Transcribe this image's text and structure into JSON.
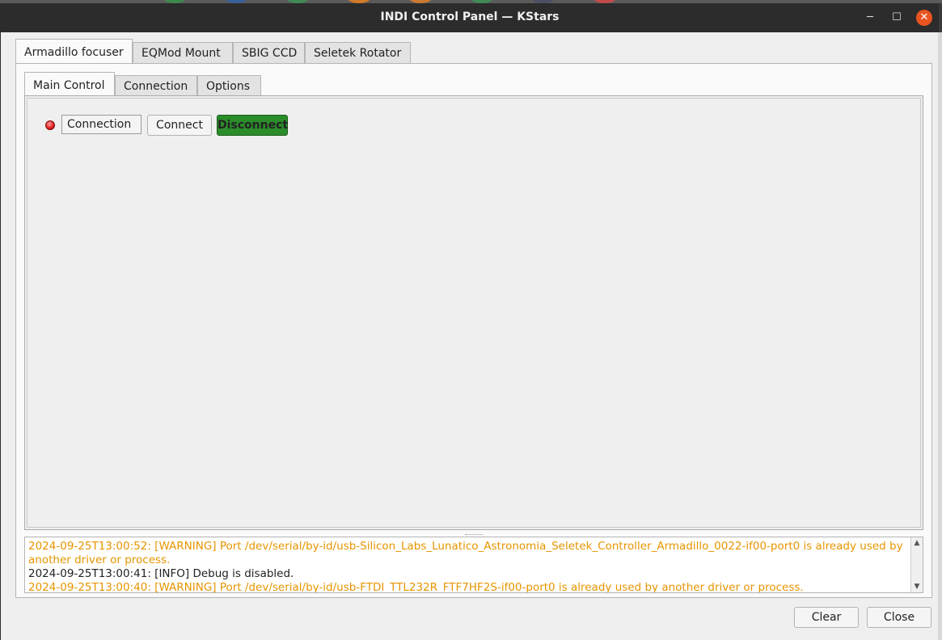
{
  "window": {
    "title": "INDI Control Panel — KStars"
  },
  "device_tabs": [
    {
      "label": "Armadillo focuser",
      "active": true
    },
    {
      "label": "EQMod Mount",
      "active": false
    },
    {
      "label": "SBIG CCD",
      "active": false
    },
    {
      "label": "Seletek Rotator",
      "active": false
    }
  ],
  "group_tabs": [
    {
      "label": "Main Control",
      "active": true
    },
    {
      "label": "Connection",
      "active": false
    },
    {
      "label": "Options",
      "active": false
    }
  ],
  "property": {
    "status_color": "#e21b1b",
    "label": "Connection",
    "buttons": [
      {
        "label": "Connect",
        "on": false
      },
      {
        "label": "Disconnect",
        "on": true
      }
    ]
  },
  "log": [
    {
      "level": "warning",
      "text": "2024-09-25T13:00:52: [WARNING] Port /dev/serial/by-id/usb-Silicon_Labs_Lunatico_Astronomia_Seletek_Controller_Armadillo_0022-if00-port0 is already used by another driver or process."
    },
    {
      "level": "info",
      "text": "2024-09-25T13:00:41: [INFO] Debug is disabled."
    },
    {
      "level": "warning",
      "text": "2024-09-25T13:00:40: [WARNING] Port /dev/serial/by-id/usb-FTDI_TTL232R_FTF7HF2S-if00-port0 is already used by another driver or process."
    }
  ],
  "footer": {
    "clear_label": "Clear",
    "close_label": "Close"
  },
  "colors": {
    "warning": "#e69500",
    "connected_button": "#2a8d2a",
    "titlebar": "#2c2c2c",
    "close_button": "#e95420"
  }
}
